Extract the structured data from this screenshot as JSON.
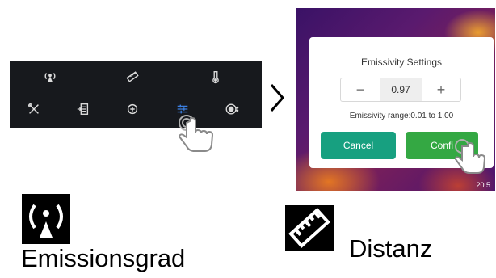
{
  "toolbar": {
    "top_row": [
      {
        "icon": "emissivity-icon"
      },
      {
        "icon": "ruler-icon"
      },
      {
        "icon": "thermometer-icon"
      }
    ],
    "bottom_row": [
      {
        "icon": "tools-icon"
      },
      {
        "icon": "report-icon"
      },
      {
        "icon": "crosshair-icon"
      },
      {
        "icon": "settings-sliders-icon",
        "active": true
      },
      {
        "icon": "palette-icon"
      }
    ],
    "active_color": "#3b7fe0"
  },
  "dialog": {
    "title": "Emissivity Settings",
    "minus": "−",
    "value": "0.97",
    "plus": "+",
    "range_text": "Emissivity range:0.01 to 1.00",
    "cancel_label": "Cancel",
    "confirm_label": "Confi",
    "cancel_color": "#17a080",
    "confirm_color": "#34a843"
  },
  "thermal": {
    "temp_label": "20.5"
  },
  "legend": {
    "emission_label": "Emissionsgrad",
    "distance_label": "Distanz"
  }
}
